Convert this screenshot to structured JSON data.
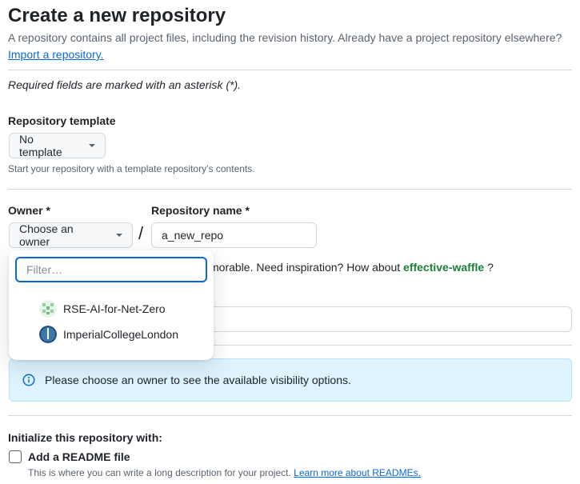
{
  "header": {
    "title": "Create a new repository",
    "description": "A repository contains all project files, including the revision history. Already have a project repository elsewhere?",
    "import_link": "Import a repository."
  },
  "required_note": "Required fields are marked with an asterisk (*).",
  "template": {
    "label": "Repository template",
    "button": "No template",
    "help": "Start your repository with a template repository’s contents."
  },
  "owner": {
    "label": "Owner *",
    "button": "Choose an owner",
    "separator": "/"
  },
  "repo_name": {
    "label": "Repository name *",
    "value": "a_new_repo"
  },
  "name_hint": {
    "text": "morable. Need inspiration? How about",
    "suggestion": "effective-waffle",
    "suffix": "?"
  },
  "owner_dropdown": {
    "filter_placeholder": "Filter…",
    "options": [
      {
        "label": "RSE-AI-for-Net-Zero",
        "icon": "identicon-green"
      },
      {
        "label": "ImperialCollegeLondon",
        "icon": "imperial-logo"
      }
    ]
  },
  "visibility_notice": "Please choose an owner to see the available visibility options.",
  "initialize": {
    "heading": "Initialize this repository with:",
    "readme_label": "Add a README file",
    "readme_help": "This is where you can write a long description for your project.",
    "readme_link": "Learn more about READMEs."
  },
  "colors": {
    "accent": "#0969da",
    "success": "#1a7f37",
    "info_bg": "#ddf4ff"
  }
}
